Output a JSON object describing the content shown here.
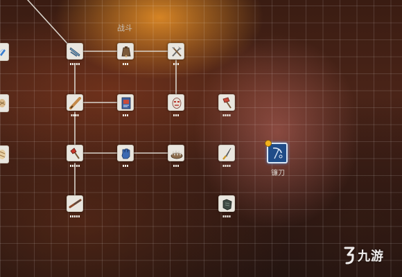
{
  "screen": {
    "section_title": "战斗"
  },
  "featured_node": {
    "label": "镰刀",
    "icon": "scythe-icon",
    "badge": "upgrade-arrow-icon"
  },
  "nodes": [
    {
      "id": "n-sword-1",
      "icon": "blade-icon"
    },
    {
      "id": "n-bell",
      "icon": "cowbell-icon"
    },
    {
      "id": "n-tools",
      "icon": "crossed-tools-icon"
    },
    {
      "id": "n-bat",
      "icon": "baseball-bat-icon"
    },
    {
      "id": "n-card",
      "icon": "skill-card-icon"
    },
    {
      "id": "n-mask",
      "icon": "mask-icon"
    },
    {
      "id": "n-sledge",
      "icon": "sledgehammer-icon"
    },
    {
      "id": "n-axe",
      "icon": "fire-axe-icon"
    },
    {
      "id": "n-glove",
      "icon": "glove-icon"
    },
    {
      "id": "n-trap",
      "icon": "bear-trap-icon"
    },
    {
      "id": "n-knife",
      "icon": "knife-icon"
    },
    {
      "id": "n-rifle",
      "icon": "rifle-icon"
    },
    {
      "id": "n-armor",
      "icon": "armor-icon"
    }
  ],
  "edge_nodes": [
    {
      "icon": "blue-item-icon"
    },
    {
      "icon": "wrapped-item-icon"
    },
    {
      "icon": "bandage-icon"
    }
  ],
  "watermark": {
    "text": "九游"
  }
}
